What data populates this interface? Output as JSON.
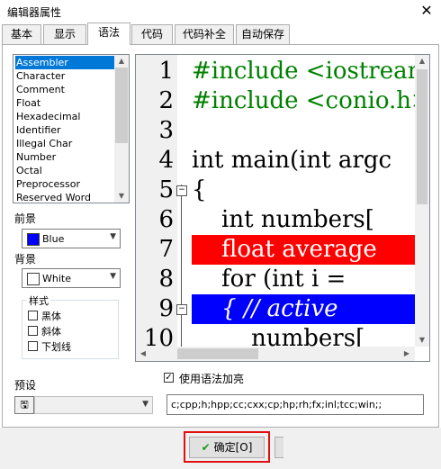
{
  "window": {
    "title": "编辑器属性",
    "close_glyph": "✕"
  },
  "tabs": [
    {
      "label": "基本"
    },
    {
      "label": "显示"
    },
    {
      "label": "语法"
    },
    {
      "label": "代码"
    },
    {
      "label": "代码补全"
    },
    {
      "label": "自动保存"
    }
  ],
  "active_tab": "语法",
  "elements": {
    "items": [
      "Assembler",
      "Character",
      "Comment",
      "Float",
      "Hexadecimal",
      "Identifier",
      "Illegal Char",
      "Number",
      "Octal",
      "Preprocessor",
      "Reserved Word"
    ],
    "selected": "Assembler"
  },
  "foreground": {
    "label": "前景",
    "value": "Blue",
    "color": "#0000ff"
  },
  "background": {
    "label": "背景",
    "value": "White",
    "color": "#ffffff"
  },
  "style": {
    "label": "样式",
    "bold": "黑体",
    "italic": "斜体",
    "underline": "下划线"
  },
  "preview": {
    "line_numbers": [
      "1",
      "2",
      "3",
      "4",
      "5",
      "6",
      "7",
      "8",
      "9",
      "10"
    ],
    "lines": [
      "#include <iostream>",
      "#include <conio.h>",
      "",
      "int main(int argc",
      "{",
      "    int numbers[",
      "    float average",
      "    for (int i =",
      "    { // active",
      "        numbers["
    ],
    "fold_glyph": "−",
    "colors": {
      "include": "#008000",
      "error_bg": "#ff0000",
      "active_bg": "#0000ff"
    }
  },
  "syntax": {
    "enable_label": "使用语法加亮",
    "checked": true
  },
  "preset": {
    "label": "预设",
    "value": ""
  },
  "extensions": "c;cpp;h;hpp;cc;cxx;cp;hp;rh;fx;inl;tcc;win;;",
  "buttons": {
    "ok": "确定[O]"
  }
}
